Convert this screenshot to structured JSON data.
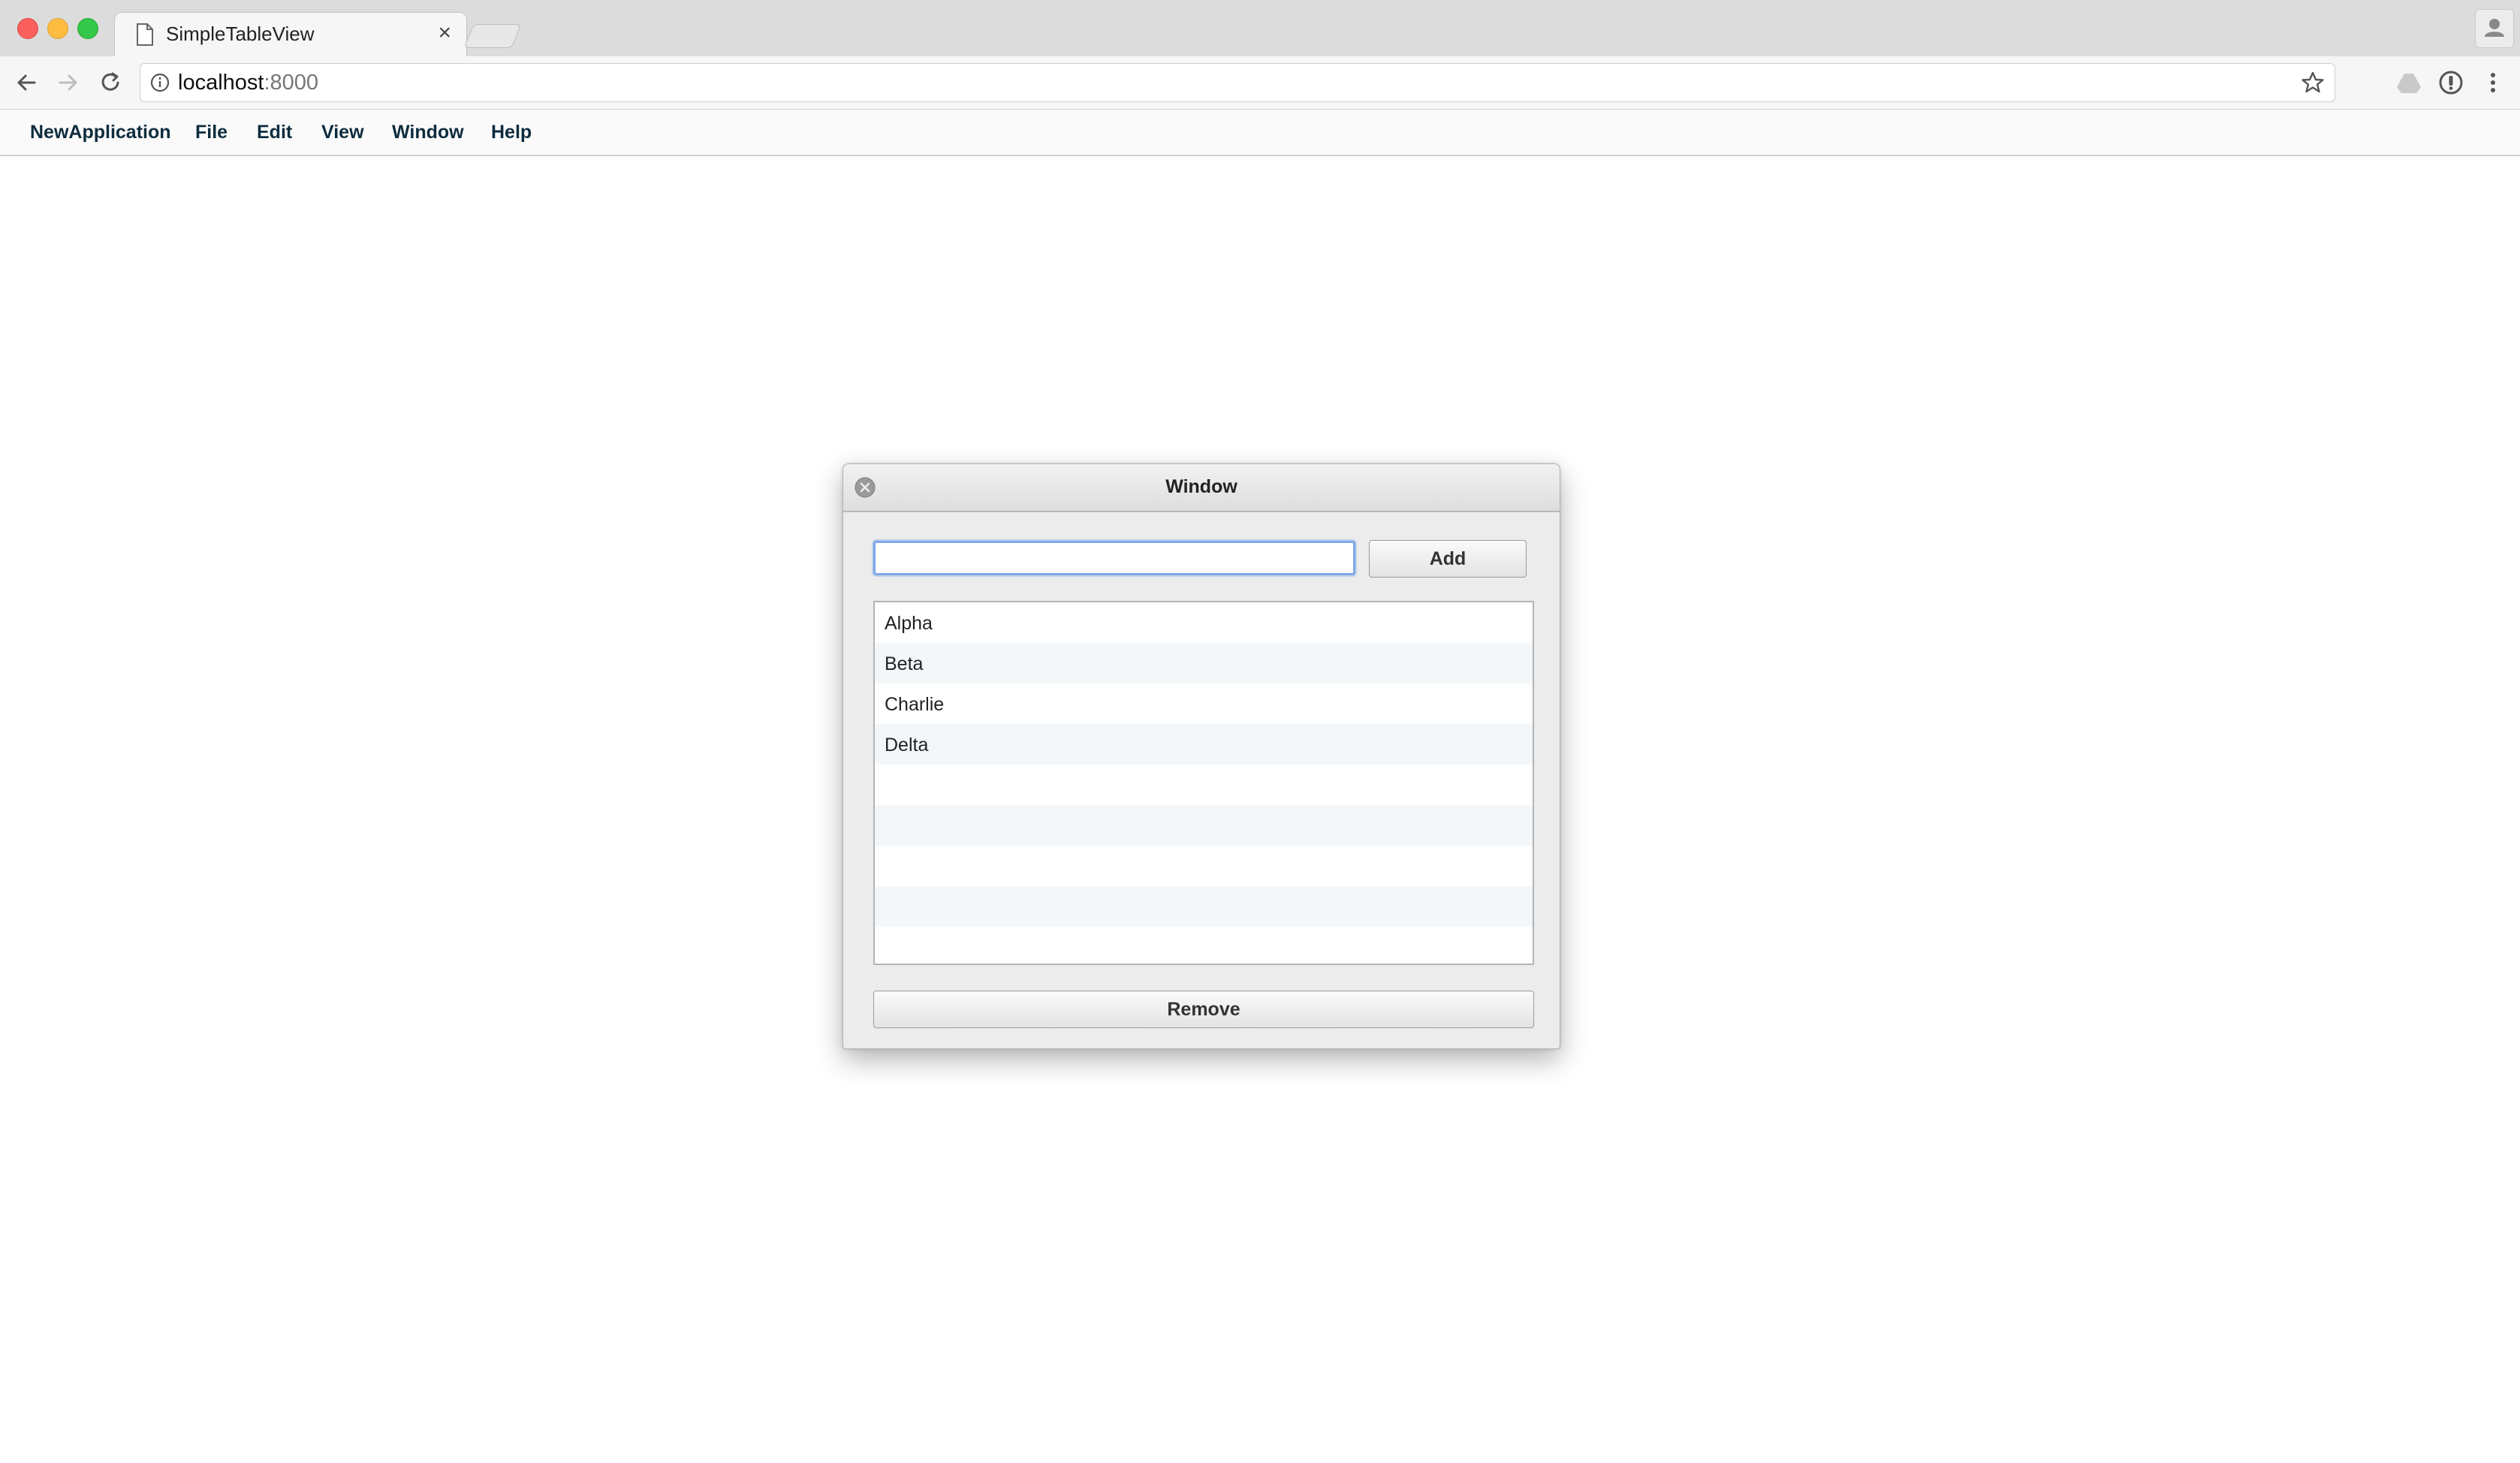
{
  "browser": {
    "tab_title": "SimpleTableView",
    "tab_close": "×",
    "url_host": "localhost",
    "url_port": ":8000"
  },
  "menubar": {
    "items": [
      "NewApplication",
      "File",
      "Edit",
      "View",
      "Window",
      "Help"
    ]
  },
  "window": {
    "title": "Window",
    "input_value": "",
    "add_label": "Add",
    "remove_label": "Remove",
    "rows": [
      "Alpha",
      "Beta",
      "Charlie",
      "Delta",
      "",
      "",
      "",
      "",
      ""
    ]
  }
}
